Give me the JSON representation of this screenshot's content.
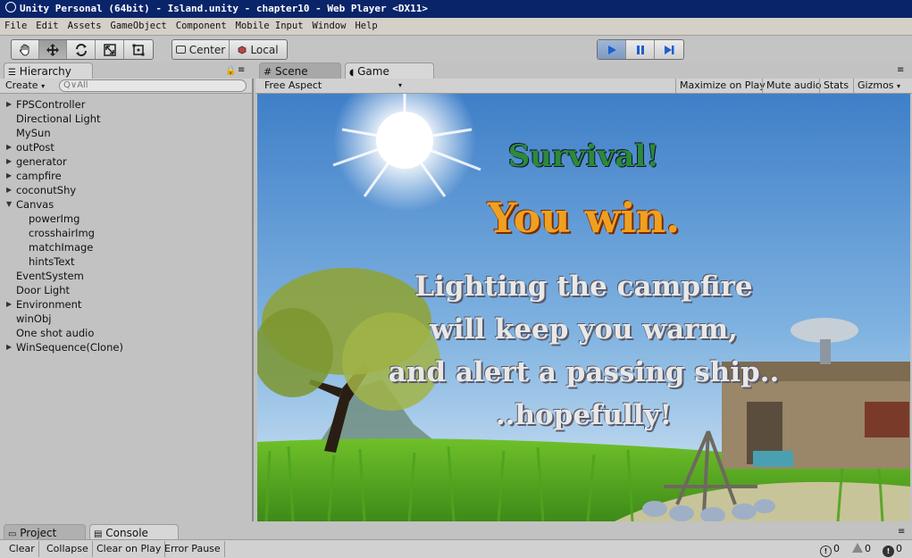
{
  "window": {
    "title": "Unity Personal (64bit) - Island.unity - chapter10 - Web Player <DX11>"
  },
  "menu": [
    "File",
    "Edit",
    "Assets",
    "GameObject",
    "Component",
    "Mobile Input",
    "Window",
    "Help"
  ],
  "toolbar": {
    "pivot_label": "Center",
    "space_label": "Local",
    "tools": [
      "hand-icon",
      "move-icon",
      "rotate-icon",
      "scale-icon",
      "rect-tool-icon"
    ]
  },
  "hierarchy": {
    "tab_label": "Hierarchy",
    "create_label": "Create",
    "search_placeholder": "Q∨All",
    "items": [
      {
        "label": "FPSController",
        "indent": 0,
        "arrow": "right"
      },
      {
        "label": "Directional Light",
        "indent": 0,
        "arrow": ""
      },
      {
        "label": "MySun",
        "indent": 0,
        "arrow": ""
      },
      {
        "label": "outPost",
        "indent": 0,
        "arrow": "right"
      },
      {
        "label": "generator",
        "indent": 0,
        "arrow": "right"
      },
      {
        "label": "campfire",
        "indent": 0,
        "arrow": "right"
      },
      {
        "label": "coconutShy",
        "indent": 0,
        "arrow": "right"
      },
      {
        "label": "Canvas",
        "indent": 0,
        "arrow": "down"
      },
      {
        "label": "powerImg",
        "indent": 1,
        "arrow": ""
      },
      {
        "label": "crosshairImg",
        "indent": 1,
        "arrow": ""
      },
      {
        "label": "matchImage",
        "indent": 1,
        "arrow": ""
      },
      {
        "label": "hintsText",
        "indent": 1,
        "arrow": ""
      },
      {
        "label": "EventSystem",
        "indent": 0,
        "arrow": ""
      },
      {
        "label": "Door Light",
        "indent": 0,
        "arrow": ""
      },
      {
        "label": "Environment",
        "indent": 0,
        "arrow": "right"
      },
      {
        "label": "winObj",
        "indent": 0,
        "arrow": ""
      },
      {
        "label": "One shot audio",
        "indent": 0,
        "arrow": ""
      },
      {
        "label": "WinSequence(Clone)",
        "indent": 0,
        "arrow": "right"
      }
    ]
  },
  "view_tabs": {
    "scene": "Scene",
    "game": "Game"
  },
  "game_toolbar": {
    "aspect": "Free Aspect",
    "maximize": "Maximize on Play",
    "mute": "Mute audio",
    "stats": "Stats",
    "gizmos": "Gizmos"
  },
  "game_view": {
    "title": "Survival!",
    "headline": "You win.",
    "message_lines": [
      "Lighting the campfire",
      "will keep you warm,",
      "and alert a passing ship..",
      "..hopefully!"
    ],
    "colors": {
      "title": "#2c8a3a",
      "headline": "#f0a020",
      "message": "#e8e8e8"
    }
  },
  "bottom_tabs": {
    "project": "Project",
    "console": "Console"
  },
  "console": {
    "clear": "Clear",
    "collapse": "Collapse",
    "clear_on_play": "Clear on Play",
    "error_pause": "Error Pause",
    "info_count": "0",
    "warn_count": "0",
    "error_count": "0"
  }
}
